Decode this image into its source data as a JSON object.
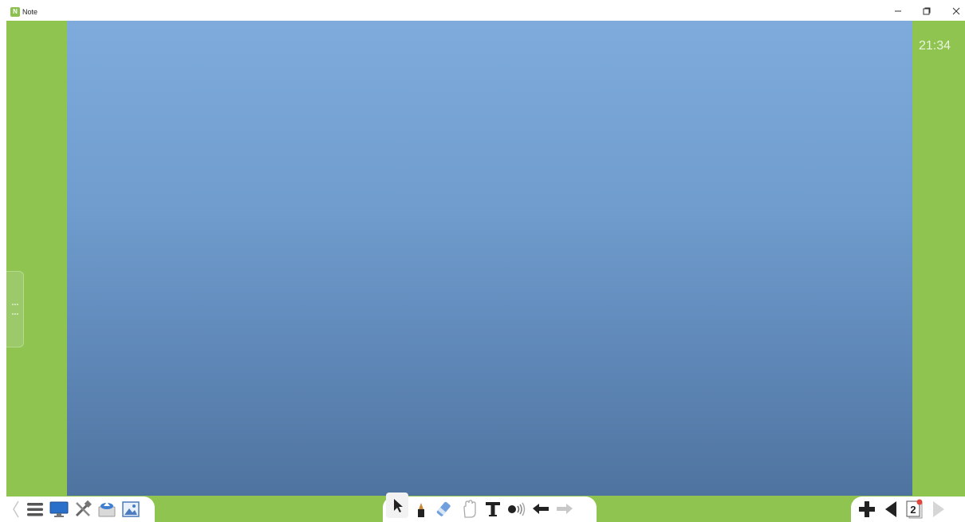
{
  "window": {
    "title": "Note",
    "icon": "app-note-icon",
    "controls": [
      "minimize-icon",
      "maximize-icon",
      "close-icon"
    ]
  },
  "clock": {
    "time": "21:34"
  },
  "colors": {
    "stage_green": "#8fc450",
    "board_top": "#7eabdc",
    "board_bottom": "#4f739f",
    "toolbar_bg": "#ffffff"
  },
  "left_toolbar": {
    "tools": [
      "chevron-left-icon",
      "menu-icon",
      "monitor-icon",
      "tools-icon",
      "cloud-folder-icon",
      "image-icon"
    ]
  },
  "center_toolbar": {
    "tools": [
      "select-arrow-icon",
      "pen-icon",
      "eraser-icon",
      "hand-icon",
      "text-icon",
      "sound-icon",
      "undo-icon",
      "redo-icon"
    ],
    "active_tool": "select-arrow-icon"
  },
  "right_toolbar": {
    "tools": [
      "add-page-icon",
      "previous-page-icon",
      "page-list-icon",
      "next-page-icon"
    ],
    "current_page": "2"
  }
}
